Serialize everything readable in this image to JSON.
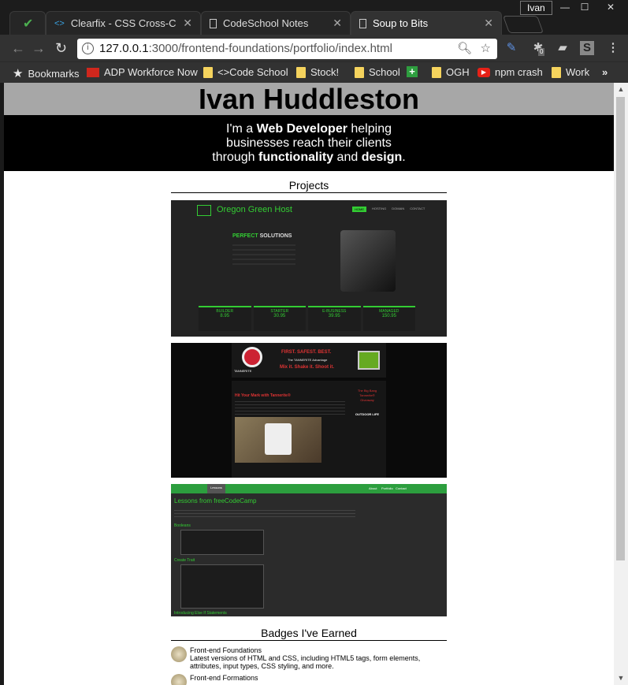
{
  "window": {
    "user": "Ivan"
  },
  "tabs": [
    {
      "label": "",
      "icon": "check-icon"
    },
    {
      "label": "Clearfix - CSS Cross-Cou",
      "icon": "code-icon"
    },
    {
      "label": "CodeSchool Notes",
      "icon": "document-icon"
    },
    {
      "label": "Soup to Bits",
      "icon": "document-icon"
    }
  ],
  "address": {
    "host": "127.0.0.1",
    "path": ":3000/frontend-foundations/portfolio/index.html"
  },
  "extensions": {
    "badge_count": "0"
  },
  "bookmarks": [
    {
      "label": "Bookmarks"
    },
    {
      "label": "ADP Workforce Now"
    },
    {
      "label": "<>Code School"
    },
    {
      "label": "Stock!"
    },
    {
      "label": "School"
    },
    {
      "label": ""
    },
    {
      "label": "OGH"
    },
    {
      "label": "npm crash"
    },
    {
      "label": "Work"
    },
    {
      "label": "»"
    }
  ],
  "site": {
    "name": "Ivan Huddleston",
    "tagline": {
      "p1": "I'm a ",
      "b1": "Web Developer",
      "p2": " helping",
      "line2": "businesses reach their clients",
      "p3": "through ",
      "b2": "functionality",
      "p4": " and ",
      "b3": "design",
      "p5": "."
    },
    "projects_title": "Projects",
    "badges_title": "Badges I've Earned",
    "badges": [
      {
        "name": "Front-end Foundations",
        "desc": "Latest versions of HTML and CSS, including HTML5 tags, form elements, attributes, input types, CSS styling, and more."
      },
      {
        "name": "Front-end Formations",
        "desc": ""
      }
    ]
  },
  "project1": {
    "brand": "Oregon Green Host",
    "nav": [
      "HOME",
      "HOSTING",
      "DOMAIN",
      "CONTACT"
    ],
    "headline_a": "PERFECT",
    "headline_b": " SOLUTIONS",
    "plans": [
      {
        "name": "BUILDER",
        "price": "8.95"
      },
      {
        "name": "STARTER",
        "price": "30.95"
      },
      {
        "name": "E-BUSINESS",
        "price": "39.95"
      },
      {
        "name": "MANAGED",
        "price": "150.95"
      }
    ]
  },
  "project2": {
    "logo": "TANNERITE",
    "slogan1": "FIRST. SAFEST. BEST.",
    "slogan2": "The TANNERITE Advantage",
    "slogan3": "Mix it. Shake it. Shoot it.",
    "heading": "Hit Your Mark with Tannerite®",
    "side1": "The Big Bang",
    "side2": "Tannerite®",
    "side3": "Giveaway",
    "side4": "OUTDOOR LIFE"
  },
  "project3": {
    "nav_left": "Lessons",
    "nav_right": [
      "About",
      "Portfolio",
      "Contact"
    ],
    "title": "Lessons from freeCodeCamp",
    "sub1": "Booleans",
    "sub2": "Create Trait",
    "sub3": "Introducing Else If Statements"
  }
}
